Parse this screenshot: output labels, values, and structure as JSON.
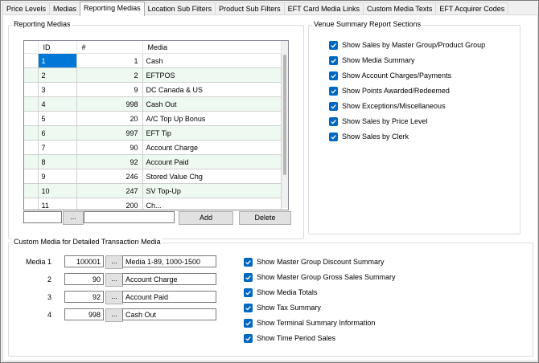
{
  "tabs": [
    "Price Levels",
    "Medias",
    "Reporting Medias",
    "Location Sub Filters",
    "Product Sub Filters",
    "EFT Card Media Links",
    "Custom Media Texts",
    "EFT Acquirer Codes"
  ],
  "reporting_medias": {
    "title": "Reporting Medias",
    "columns": [
      "ID",
      "#",
      "Media"
    ],
    "rows": [
      {
        "id": "1",
        "num": "1",
        "media": "Cash"
      },
      {
        "id": "2",
        "num": "2",
        "media": "EFTPOS"
      },
      {
        "id": "3",
        "num": "9",
        "media": "DC Canada & US"
      },
      {
        "id": "4",
        "num": "998",
        "media": "Cash Out"
      },
      {
        "id": "5",
        "num": "20",
        "media": "A/C Top Up Bonus"
      },
      {
        "id": "6",
        "num": "997",
        "media": "EFT Tip"
      },
      {
        "id": "7",
        "num": "90",
        "media": "Account Charge"
      },
      {
        "id": "8",
        "num": "92",
        "media": "Account Paid"
      },
      {
        "id": "9",
        "num": "246",
        "media": "Stored Value Chg"
      },
      {
        "id": "10",
        "num": "247",
        "media": "SV Top-Up"
      },
      {
        "id": "11",
        "num": "200",
        "media": "Ch..."
      }
    ],
    "browse_label": "...",
    "add_label": "Add",
    "delete_label": "Delete"
  },
  "venue_summary": {
    "title": "Venue Summary Report Sections",
    "options": [
      "Show Sales by Master Group/Product Group",
      "Show Media Summary",
      "Show Account Charges/Payments",
      "Show Points Awarded/Redeemed",
      "Show Exceptions/Miscellaneous",
      "Show Sales by Price Level",
      "Show Sales by Clerk"
    ]
  },
  "custom_media": {
    "title": "Custom Media for Detailed Transaction Media",
    "rows": [
      {
        "label": "Media 1",
        "code": "100001",
        "text": "Media 1-89, 1000-1500"
      },
      {
        "label": "2",
        "code": "90",
        "text": "Account Charge"
      },
      {
        "label": "3",
        "code": "92",
        "text": "Account Paid"
      },
      {
        "label": "4",
        "code": "998",
        "text": "Cash Out"
      }
    ],
    "browse_label": "...",
    "options": [
      "Show Master Group Discount Summary",
      "Show Master Group Gross Sales Summary",
      "Show Media Totals",
      "Show Tax Summary",
      "Show Terminal Summary Information",
      "Show Time Period Sales"
    ]
  }
}
